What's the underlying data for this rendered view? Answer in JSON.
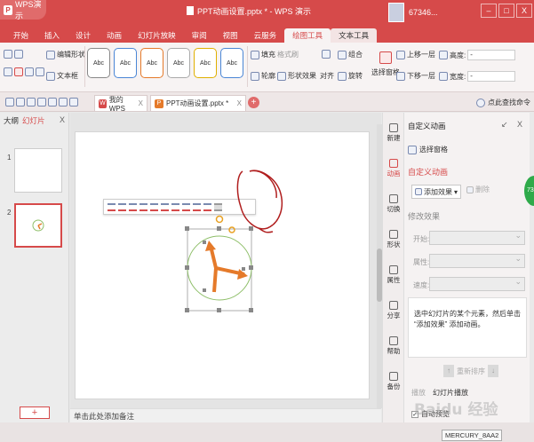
{
  "app": {
    "name": "WPS演示",
    "doc_title": "PPT动画设置.pptx * - WPS 演示",
    "user": "67346..."
  },
  "window": {
    "min": "–",
    "max": "□",
    "close": "X"
  },
  "menu": [
    "开始",
    "插入",
    "设计",
    "动画",
    "幻灯片放映",
    "审阅",
    "视图",
    "云服务",
    "绘图工具",
    "文本工具"
  ],
  "ribbon": {
    "edit_shape": "编辑形状",
    "text_box": "文本框",
    "abc": "Abc",
    "fill": "填充",
    "format_brush": "格式刷",
    "outline": "轮廓",
    "shape_effect": "形状效果",
    "combine": "组合",
    "align": "对齐",
    "rotate": "旋转",
    "select_pane": "选择窗格",
    "bring_forward": "上移一层",
    "send_backward": "下移一层",
    "height": "高度:",
    "width": "宽度:",
    "stepper": "-"
  },
  "tabs": {
    "home": "我的WPS",
    "doc": "PPT动画设置.pptx *",
    "close": "X",
    "search": "点此查找命令"
  },
  "left_panel": {
    "outline": "大纲",
    "slides": "幻灯片",
    "close": "X",
    "n1": "1",
    "n2": "2",
    "add": "+"
  },
  "notes": "单击此处添加备注",
  "rail": [
    "新建",
    "动画",
    "切换",
    "形状",
    "属性",
    "分享",
    "帮助",
    "备份"
  ],
  "anim": {
    "title": "自定义动画",
    "ctrls": "↙ X",
    "select_pane": "选择窗格",
    "section": "自定义动画",
    "add_effect": "添加效果",
    "delete": "删除",
    "modify": "修改效果",
    "start": "开始:",
    "property": "属性:",
    "speed": "速度:",
    "hint": "选中幻灯片的某个元素，然后单击 “添加效果” 添加动画。",
    "reorder": "重新排序",
    "play": "播放",
    "slideshow": "幻灯片播放",
    "autopreview": "自动预览",
    "checkmark": "✓"
  },
  "tooltip": "MERCURY_8AA2",
  "badge": "73",
  "watermark": "Baidu 经验"
}
